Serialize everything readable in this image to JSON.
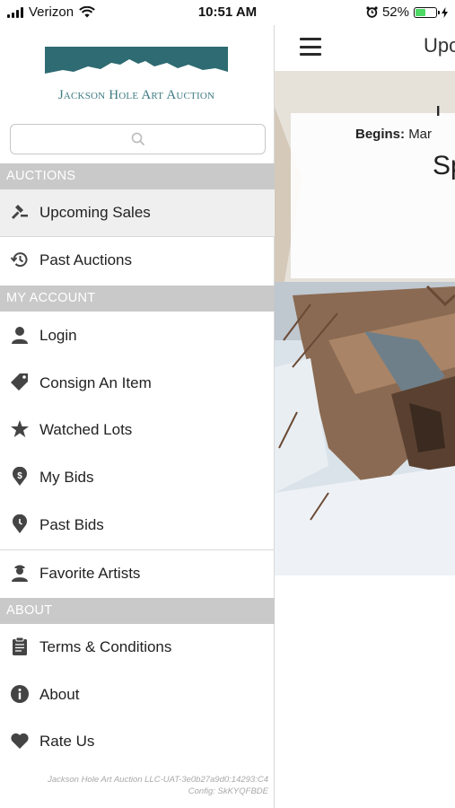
{
  "status_bar": {
    "carrier": "Verizon",
    "time": "10:51 AM",
    "battery_percent": "52%",
    "battery_level": 0.52,
    "battery_color": "#4cd964"
  },
  "drawer": {
    "logo_text": "Jackson Hole Art Auction",
    "logo_color": "#3e7b82",
    "search": {
      "value": "",
      "placeholder": ""
    },
    "sections": {
      "auctions": "AUCTIONS",
      "my_account": "MY ACCOUNT",
      "about": "ABOUT"
    },
    "items": {
      "upcoming_sales": {
        "label": "Upcoming Sales",
        "icon": "gavel-icon",
        "active": true
      },
      "past_auctions": {
        "label": "Past Auctions",
        "icon": "history-icon"
      },
      "login": {
        "label": "Login",
        "icon": "user-icon"
      },
      "consign": {
        "label": "Consign An Item",
        "icon": "tag-icon"
      },
      "watched_lots": {
        "label": "Watched Lots",
        "icon": "star-icon"
      },
      "my_bids": {
        "label": "My Bids",
        "icon": "dollar-pin-icon"
      },
      "past_bids": {
        "label": "Past Bids",
        "icon": "clock-pin-icon"
      },
      "favorite_artists": {
        "label": "Favorite Artists",
        "icon": "artist-icon"
      },
      "terms": {
        "label": "Terms & Conditions",
        "icon": "clipboard-icon"
      },
      "about": {
        "label": "About",
        "icon": "info-icon"
      },
      "rate_us": {
        "label": "Rate Us",
        "icon": "heart-icon"
      }
    },
    "footer_line1": "Jackson Hole Art Auction LLC-UAT-3e0b27a9d0:14293:C4",
    "footer_line2": "Config: SkKYQFBDE"
  },
  "main": {
    "nav_title": "Upco",
    "sale_title": "Sp",
    "sale_sub": "I",
    "begins_label": "Begins:",
    "begins_value": "Mar"
  }
}
